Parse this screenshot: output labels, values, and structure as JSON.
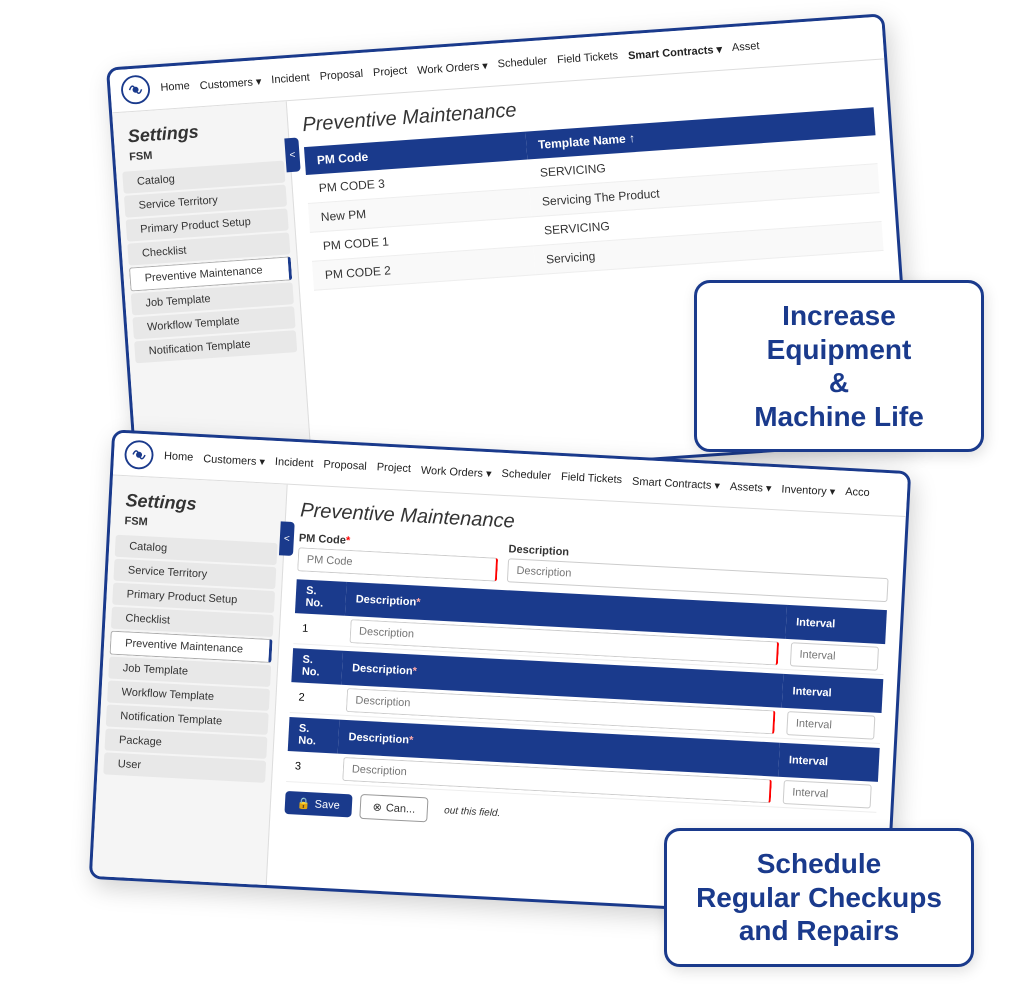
{
  "card1": {
    "navbar": {
      "items": [
        "Home",
        "Customers ▾",
        "Incident",
        "Proposal",
        "Project",
        "Work Orders ▾",
        "Scheduler",
        "Field Tickets",
        "Smart Contracts ▾",
        "Asset"
      ]
    },
    "sidebar": {
      "title": "Settings",
      "section": "FSM",
      "items": [
        {
          "label": "Catalog",
          "active": false
        },
        {
          "label": "Service Territory",
          "active": false
        },
        {
          "label": "Primary Product Setup",
          "active": false
        },
        {
          "label": "Checklist",
          "active": false
        },
        {
          "label": "Preventive Maintenance",
          "active": true
        },
        {
          "label": "Job Template",
          "active": false
        },
        {
          "label": "Workflow Template",
          "active": false
        },
        {
          "label": "Notification Template",
          "active": false
        }
      ]
    },
    "main": {
      "title": "Preventive Maintenance",
      "table": {
        "headers": [
          "PM Code",
          "Template Name ↑"
        ],
        "rows": [
          {
            "code": "PM CODE 3",
            "template": "SERVICING"
          },
          {
            "code": "New PM",
            "template": "Servicing The Product"
          },
          {
            "code": "PM CODE 1",
            "template": "SERVICING"
          },
          {
            "code": "PM CODE 2",
            "template": "Servicing"
          }
        ]
      }
    }
  },
  "card2": {
    "navbar": {
      "items": [
        "Home",
        "Customers ▾",
        "Incident",
        "Proposal",
        "Project",
        "Work Orders ▾",
        "Scheduler",
        "Field Tickets",
        "Smart Contracts ▾",
        "Assets ▾",
        "Inventory ▾",
        "Acco"
      ]
    },
    "sidebar": {
      "title": "Settings",
      "section": "FSM",
      "items": [
        {
          "label": "Catalog",
          "active": false
        },
        {
          "label": "Service Territory",
          "active": false
        },
        {
          "label": "Primary Product Setup",
          "active": false
        },
        {
          "label": "Checklist",
          "active": false
        },
        {
          "label": "Preventive Maintenance",
          "active": true
        },
        {
          "label": "Job Template",
          "active": false
        },
        {
          "label": "Workflow Template",
          "active": false
        },
        {
          "label": "Notification Template",
          "active": false
        },
        {
          "label": "Package",
          "active": false
        },
        {
          "label": "User",
          "active": false
        }
      ]
    },
    "main": {
      "title": "Preventive Maintenance",
      "pm_code_label": "PM Code",
      "pm_code_placeholder": "PM Code",
      "description_label": "Description",
      "description_placeholder": "Description",
      "interval_rows": [
        {
          "sno": "1",
          "desc_placeholder": "Description",
          "interval_placeholder": "Interval"
        },
        {
          "sno": "2",
          "desc_placeholder": "Description",
          "interval_placeholder": "Interval"
        },
        {
          "sno": "3",
          "desc_placeholder": "Description",
          "interval_placeholder": "Interval"
        }
      ],
      "validation_msg": "out this field.",
      "save_label": "Save",
      "cancel_label": "Can..."
    }
  },
  "callout1": {
    "text": "Increase Equipment\n&\nMachine Life"
  },
  "callout2": {
    "text": "Schedule\nRegular Checkups\nand Repairs"
  }
}
